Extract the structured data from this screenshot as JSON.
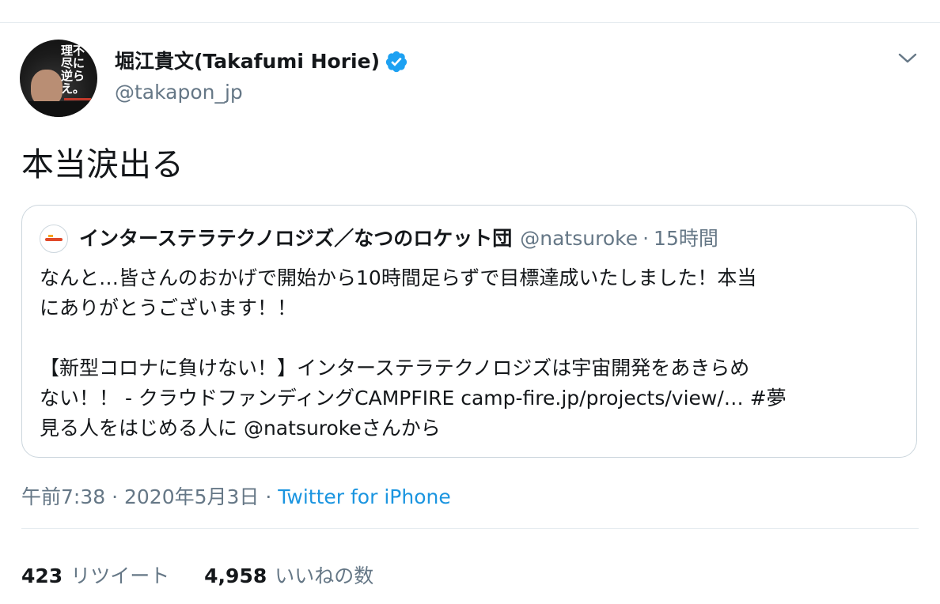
{
  "author": {
    "display_name": "堀江貴文(Takafumi Horie)",
    "handle": "@takapon_jp",
    "verified": true,
    "avatar_cover_text": "理不尽に逆らえ。"
  },
  "tweet": {
    "text": "本当涙出る"
  },
  "quoted": {
    "name": "インターステラテクノロジズ／なつのロケット団",
    "handle": "@natsuroke",
    "separator": "·",
    "time": "15時間",
    "body": "なんと…皆さんのおかげで開始から10時間足らずで目標達成いたしました！本当\nにありがとうございます！！\n\n【新型コロナに負けない！】インターステラテクノロジズは宇宙開発をあきらめ\nない！！ - クラウドファンディングCAMPFIRE camp-fire.jp/projects/view/… #夢\n見る人をはじめる人に @natsurokeさんから"
  },
  "meta": {
    "time": "午前7:38",
    "sep1": " · ",
    "date": "2020年5月3日",
    "sep2": " · ",
    "source": "Twitter for iPhone"
  },
  "stats": {
    "retweets": "423",
    "retweets_label": "リツイート",
    "likes": "4,958",
    "likes_label": "いいねの数"
  },
  "colors": {
    "text": "#14171a",
    "secondary": "#657786",
    "link": "#1b95e0",
    "border": "#ccd6dd",
    "verified": "#1da1f2"
  },
  "icons": [
    "verified-badge-icon",
    "chevron-down-icon"
  ]
}
